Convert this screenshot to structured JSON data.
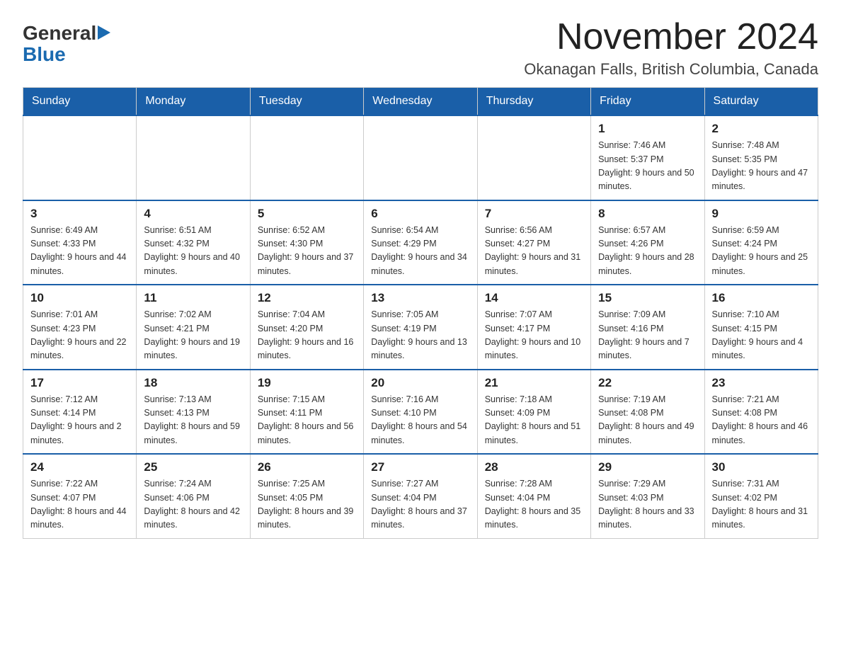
{
  "header": {
    "logo": {
      "general": "General",
      "triangle_symbol": "▶",
      "blue": "Blue"
    },
    "title": "November 2024",
    "location": "Okanagan Falls, British Columbia, Canada"
  },
  "weekdays": [
    "Sunday",
    "Monday",
    "Tuesday",
    "Wednesday",
    "Thursday",
    "Friday",
    "Saturday"
  ],
  "weeks": [
    [
      {
        "day": "",
        "info": ""
      },
      {
        "day": "",
        "info": ""
      },
      {
        "day": "",
        "info": ""
      },
      {
        "day": "",
        "info": ""
      },
      {
        "day": "",
        "info": ""
      },
      {
        "day": "1",
        "info": "Sunrise: 7:46 AM\nSunset: 5:37 PM\nDaylight: 9 hours and 50 minutes."
      },
      {
        "day": "2",
        "info": "Sunrise: 7:48 AM\nSunset: 5:35 PM\nDaylight: 9 hours and 47 minutes."
      }
    ],
    [
      {
        "day": "3",
        "info": "Sunrise: 6:49 AM\nSunset: 4:33 PM\nDaylight: 9 hours and 44 minutes."
      },
      {
        "day": "4",
        "info": "Sunrise: 6:51 AM\nSunset: 4:32 PM\nDaylight: 9 hours and 40 minutes."
      },
      {
        "day": "5",
        "info": "Sunrise: 6:52 AM\nSunset: 4:30 PM\nDaylight: 9 hours and 37 minutes."
      },
      {
        "day": "6",
        "info": "Sunrise: 6:54 AM\nSunset: 4:29 PM\nDaylight: 9 hours and 34 minutes."
      },
      {
        "day": "7",
        "info": "Sunrise: 6:56 AM\nSunset: 4:27 PM\nDaylight: 9 hours and 31 minutes."
      },
      {
        "day": "8",
        "info": "Sunrise: 6:57 AM\nSunset: 4:26 PM\nDaylight: 9 hours and 28 minutes."
      },
      {
        "day": "9",
        "info": "Sunrise: 6:59 AM\nSunset: 4:24 PM\nDaylight: 9 hours and 25 minutes."
      }
    ],
    [
      {
        "day": "10",
        "info": "Sunrise: 7:01 AM\nSunset: 4:23 PM\nDaylight: 9 hours and 22 minutes."
      },
      {
        "day": "11",
        "info": "Sunrise: 7:02 AM\nSunset: 4:21 PM\nDaylight: 9 hours and 19 minutes."
      },
      {
        "day": "12",
        "info": "Sunrise: 7:04 AM\nSunset: 4:20 PM\nDaylight: 9 hours and 16 minutes."
      },
      {
        "day": "13",
        "info": "Sunrise: 7:05 AM\nSunset: 4:19 PM\nDaylight: 9 hours and 13 minutes."
      },
      {
        "day": "14",
        "info": "Sunrise: 7:07 AM\nSunset: 4:17 PM\nDaylight: 9 hours and 10 minutes."
      },
      {
        "day": "15",
        "info": "Sunrise: 7:09 AM\nSunset: 4:16 PM\nDaylight: 9 hours and 7 minutes."
      },
      {
        "day": "16",
        "info": "Sunrise: 7:10 AM\nSunset: 4:15 PM\nDaylight: 9 hours and 4 minutes."
      }
    ],
    [
      {
        "day": "17",
        "info": "Sunrise: 7:12 AM\nSunset: 4:14 PM\nDaylight: 9 hours and 2 minutes."
      },
      {
        "day": "18",
        "info": "Sunrise: 7:13 AM\nSunset: 4:13 PM\nDaylight: 8 hours and 59 minutes."
      },
      {
        "day": "19",
        "info": "Sunrise: 7:15 AM\nSunset: 4:11 PM\nDaylight: 8 hours and 56 minutes."
      },
      {
        "day": "20",
        "info": "Sunrise: 7:16 AM\nSunset: 4:10 PM\nDaylight: 8 hours and 54 minutes."
      },
      {
        "day": "21",
        "info": "Sunrise: 7:18 AM\nSunset: 4:09 PM\nDaylight: 8 hours and 51 minutes."
      },
      {
        "day": "22",
        "info": "Sunrise: 7:19 AM\nSunset: 4:08 PM\nDaylight: 8 hours and 49 minutes."
      },
      {
        "day": "23",
        "info": "Sunrise: 7:21 AM\nSunset: 4:08 PM\nDaylight: 8 hours and 46 minutes."
      }
    ],
    [
      {
        "day": "24",
        "info": "Sunrise: 7:22 AM\nSunset: 4:07 PM\nDaylight: 8 hours and 44 minutes."
      },
      {
        "day": "25",
        "info": "Sunrise: 7:24 AM\nSunset: 4:06 PM\nDaylight: 8 hours and 42 minutes."
      },
      {
        "day": "26",
        "info": "Sunrise: 7:25 AM\nSunset: 4:05 PM\nDaylight: 8 hours and 39 minutes."
      },
      {
        "day": "27",
        "info": "Sunrise: 7:27 AM\nSunset: 4:04 PM\nDaylight: 8 hours and 37 minutes."
      },
      {
        "day": "28",
        "info": "Sunrise: 7:28 AM\nSunset: 4:04 PM\nDaylight: 8 hours and 35 minutes."
      },
      {
        "day": "29",
        "info": "Sunrise: 7:29 AM\nSunset: 4:03 PM\nDaylight: 8 hours and 33 minutes."
      },
      {
        "day": "30",
        "info": "Sunrise: 7:31 AM\nSunset: 4:02 PM\nDaylight: 8 hours and 31 minutes."
      }
    ]
  ]
}
